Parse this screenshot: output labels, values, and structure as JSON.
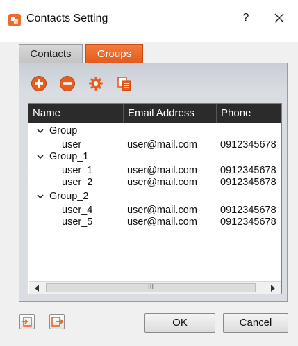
{
  "window": {
    "title": "Contacts Setting",
    "help_label": "?",
    "close_icon": "close-icon",
    "app_icon": "contacts-app-icon"
  },
  "tabs": [
    {
      "label": "Contacts",
      "active": false
    },
    {
      "label": "Groups",
      "active": true
    }
  ],
  "toolbar": {
    "add_icon": "add-icon",
    "remove_icon": "remove-icon",
    "settings_icon": "gear-icon",
    "copy_icon": "copy-icon"
  },
  "list": {
    "columns": [
      "Name",
      "Email Address",
      "Phone"
    ],
    "rows": [
      {
        "type": "group",
        "name": "Group",
        "email": "",
        "phone": ""
      },
      {
        "type": "user",
        "name": "user",
        "email": "user@mail.com",
        "phone": "0912345678"
      },
      {
        "type": "group",
        "name": "Group_1",
        "email": "",
        "phone": ""
      },
      {
        "type": "user",
        "name": "user_1",
        "email": "user@mail.com",
        "phone": "0912345678"
      },
      {
        "type": "user",
        "name": "user_2",
        "email": "user@mail.com",
        "phone": "0912345678"
      },
      {
        "type": "group",
        "name": "Group_2",
        "email": "",
        "phone": ""
      },
      {
        "type": "user",
        "name": "user_4",
        "email": "user@mail.com",
        "phone": "0912345678"
      },
      {
        "type": "user",
        "name": "user_5",
        "email": "user@mail.com",
        "phone": "0912345678"
      }
    ],
    "scrollbar_grip": "III"
  },
  "footer": {
    "import_icon": "import-icon",
    "export_icon": "export-icon",
    "ok_label": "OK",
    "cancel_label": "Cancel"
  },
  "colors": {
    "accent": "#e85d1d",
    "header_bg": "#2b2b2b",
    "dialog_bg": "#f0f0f0"
  }
}
